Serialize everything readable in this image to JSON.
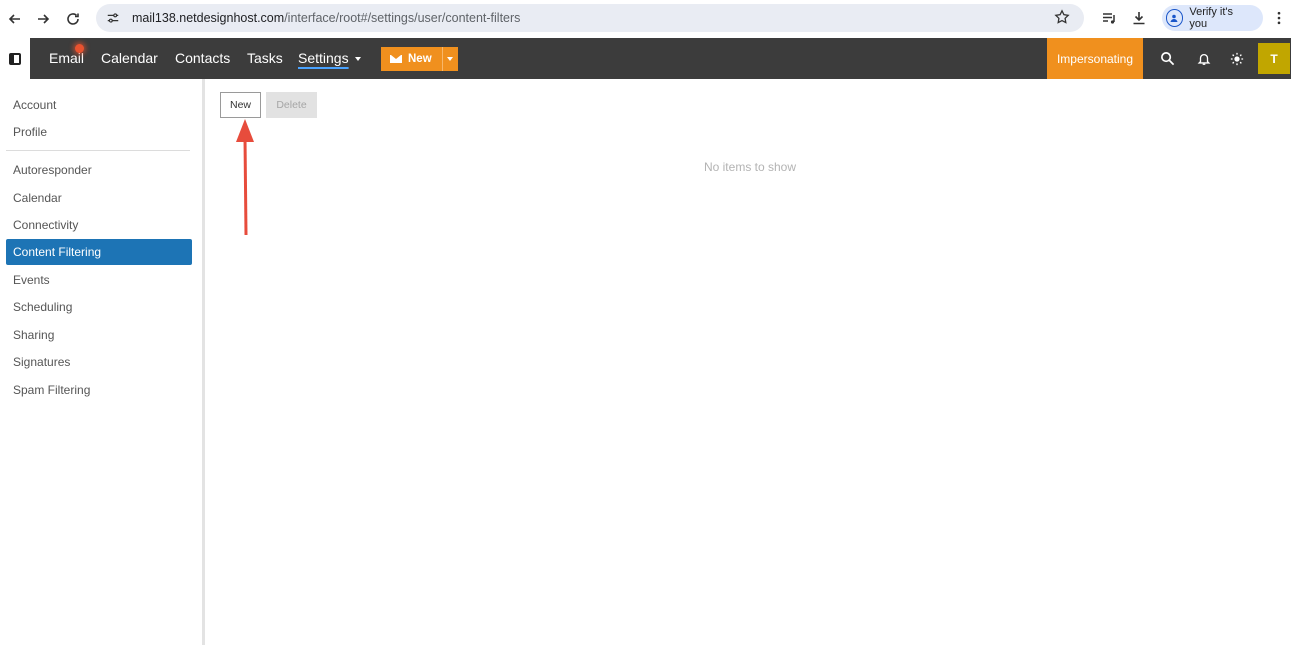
{
  "browser": {
    "url_host": "mail138.netdesignhost.com",
    "url_path": "/interface/root#/settings/user/content-filters",
    "verify_label": "Verify it's you"
  },
  "header": {
    "nav": [
      "Email",
      "Calendar",
      "Contacts",
      "Tasks",
      "Settings"
    ],
    "new_label": "New",
    "impersonating_label": "Impersonating",
    "avatar_initial": "T",
    "colors": {
      "bar": "#3c3c3c",
      "accent": "#f0901e",
      "avatar": "#c1a600"
    }
  },
  "sidebar": {
    "items": [
      "Account",
      "Profile",
      "Autoresponder",
      "Calendar",
      "Connectivity",
      "Content Filtering",
      "Events",
      "Scheduling",
      "Sharing",
      "Signatures",
      "Spam Filtering"
    ],
    "active": "Content Filtering",
    "active_color": "#1d74b5"
  },
  "toolbar": {
    "new_label": "New",
    "delete_label": "Delete"
  },
  "main": {
    "empty_message": "No items to show"
  },
  "annotation": {
    "arrow_color": "#e74c3c"
  }
}
